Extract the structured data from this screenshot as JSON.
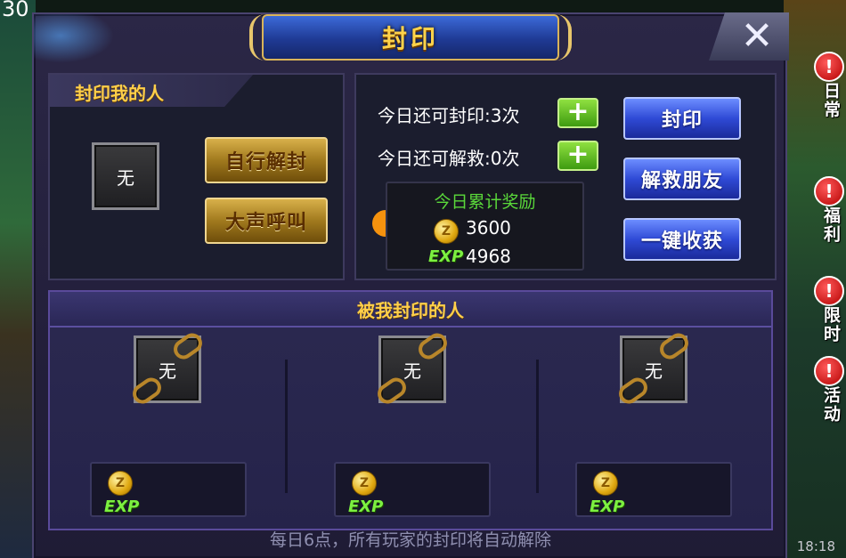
{
  "status": {
    "counter": "30",
    "clock": "18:18"
  },
  "side_tabs": [
    {
      "label": "日常",
      "alert": "!"
    },
    {
      "label": "福利",
      "alert": "!"
    },
    {
      "label": "限时",
      "alert": "!"
    },
    {
      "label": "活动",
      "alert": "!"
    }
  ],
  "dialog": {
    "title": "封印",
    "close_icon": "✕"
  },
  "sealed_me": {
    "heading": "封印我的人",
    "slot_text": "无",
    "self_unseal_label": "自行解封",
    "shout_label": "大声呼叫"
  },
  "daily": {
    "seal_remaining": "今日还可封印:3次",
    "rescue_remaining": "今日还可解救:0次",
    "plus_icon": "+",
    "reward_title": "今日累计奖励",
    "coin_value": "3600",
    "exp_label": "EXP",
    "exp_value": "4968",
    "coin_icon": "Z"
  },
  "actions": {
    "seal_label": "封印",
    "rescue_friend_label": "解救朋友",
    "collect_all_label": "一键收获"
  },
  "sealed_by_me": {
    "heading": "被我封印的人",
    "slots": [
      {
        "slot_text": "无",
        "exp_label": "EXP",
        "coin_icon": "Z"
      },
      {
        "slot_text": "无",
        "exp_label": "EXP",
        "coin_icon": "Z"
      },
      {
        "slot_text": "无",
        "exp_label": "EXP",
        "coin_icon": "Z"
      }
    ]
  },
  "footer_note": "每日6点，所有玩家的封印将自动解除",
  "colors": {
    "gold_text": "#ffcf4a",
    "green_text": "#5ad83a",
    "panel_bg": "#231f3b"
  }
}
